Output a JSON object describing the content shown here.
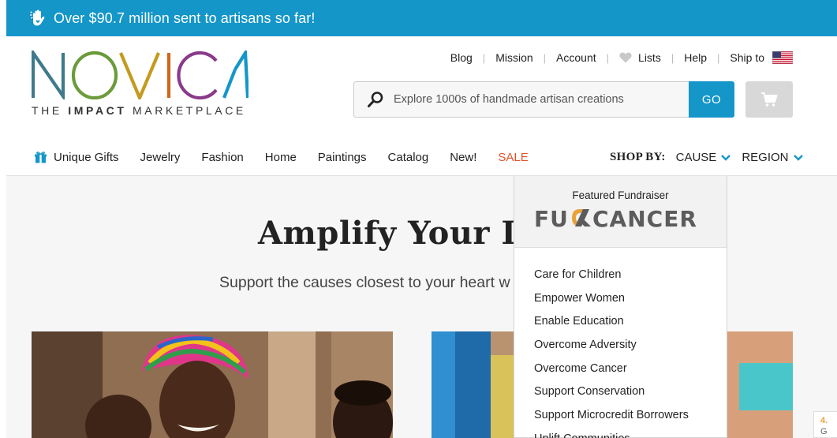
{
  "banner": {
    "text": "Over $90.7 million sent to artisans so far!",
    "icon": "hand-heart-icon",
    "bg_color": "#1496c9"
  },
  "logo": {
    "wordmark": "NOVICA",
    "tagline_pre": "THE ",
    "tagline_bold": "IMPACT",
    "tagline_post": " MARKETPLACE"
  },
  "util_nav": {
    "blog": "Blog",
    "mission": "Mission",
    "account": "Account",
    "lists": "Lists",
    "help": "Help",
    "ship_to": "Ship to"
  },
  "search": {
    "placeholder": "Explore 1000s of handmade artisan creations",
    "go_label": "GO"
  },
  "main_nav": {
    "items": [
      {
        "label": "Unique Gifts"
      },
      {
        "label": "Jewelry"
      },
      {
        "label": "Fashion"
      },
      {
        "label": "Home"
      },
      {
        "label": "Paintings"
      },
      {
        "label": "Catalog"
      },
      {
        "label": "New!"
      },
      {
        "label": "SALE"
      }
    ],
    "shop_by_label": "SHOP BY:",
    "cause": "CAUSE",
    "region": "REGION",
    "sale_color": "#e5532b"
  },
  "hero": {
    "title": "Amplify Your Imp",
    "subtitle": "Support the causes closest to your heart w"
  },
  "dropdown": {
    "featured_label": "Featured Fundraiser",
    "featured_logo_text": "FUCKCANCER",
    "items": [
      "Care for Children",
      "Empower Women",
      "Enable Education",
      "Overcome Adversity",
      "Overcome Cancer",
      "Support Conservation",
      "Support Microcredit Borrowers",
      "Uplift Communities"
    ]
  },
  "badge": {
    "value": "4.",
    "letter": "G"
  },
  "colors": {
    "accent": "#1496c9"
  }
}
